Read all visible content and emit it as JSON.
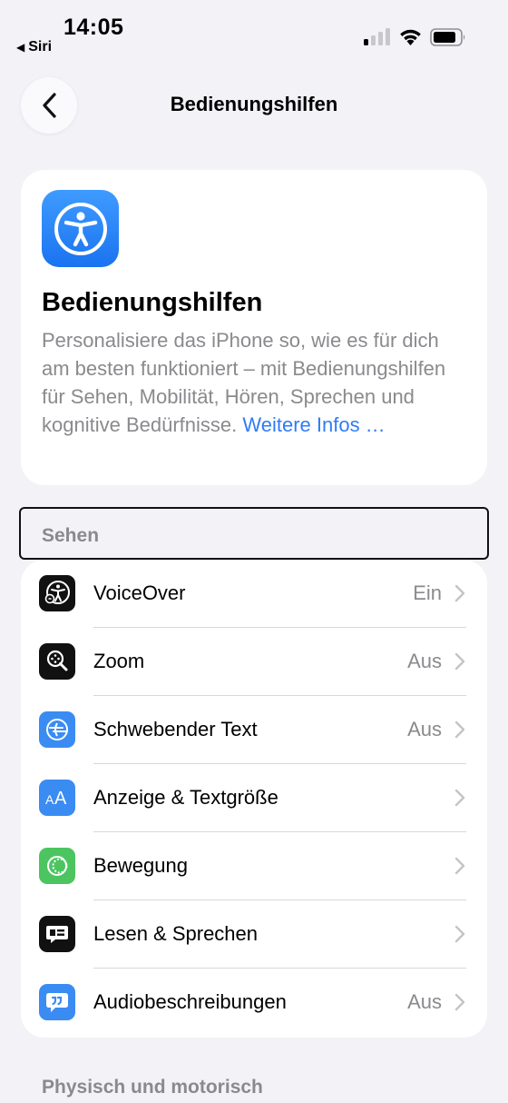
{
  "status_bar": {
    "time": "14:05",
    "back_app": "Siri",
    "back_arrow": "◀"
  },
  "nav": {
    "title": "Bedienungshilfen"
  },
  "intro": {
    "title": "Bedienungshilfen",
    "description": "Personalisiere das iPhone so, wie es für dich am besten funktioniert – mit Bedienungshilfen für Sehen, Mobilität, Hören, Sprechen und kognitive Bedürfnisse.",
    "link": "Weitere Infos …"
  },
  "sections": [
    {
      "header": "Sehen",
      "items": [
        {
          "label": "VoiceOver",
          "value": "Ein",
          "icon": "voiceover-icon",
          "icon_color": "#111111"
        },
        {
          "label": "Zoom",
          "value": "Aus",
          "icon": "zoom-icon",
          "icon_color": "#111111"
        },
        {
          "label": "Schwebender Text",
          "value": "Aus",
          "icon": "hover-text-icon",
          "icon_color": "#3a8cf2"
        },
        {
          "label": "Anzeige & Textgröße",
          "value": "",
          "icon": "text-size-icon",
          "icon_color": "#3a8cf2"
        },
        {
          "label": "Bewegung",
          "value": "",
          "icon": "motion-icon",
          "icon_color": "#4cc560"
        },
        {
          "label": "Lesen & Sprechen",
          "value": "",
          "icon": "spoken-content-icon",
          "icon_color": "#111111"
        },
        {
          "label": "Audiobeschreibungen",
          "value": "Aus",
          "icon": "audio-descriptions-icon",
          "icon_color": "#3a8cf2"
        }
      ]
    },
    {
      "header": "Physisch und motorisch"
    }
  ]
}
